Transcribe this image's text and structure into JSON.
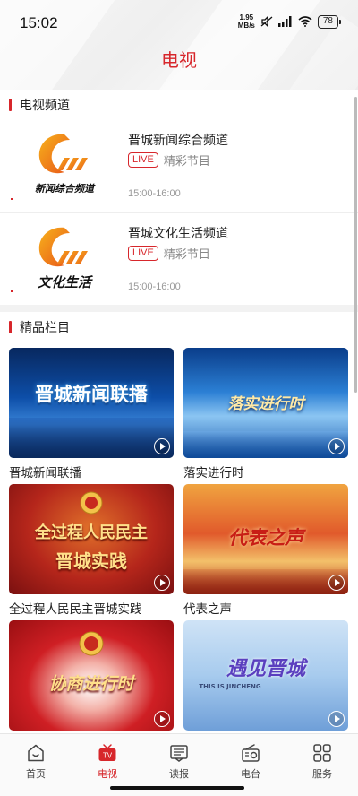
{
  "status": {
    "time": "15:02",
    "net_speed_value": "1.95",
    "net_speed_unit": "MB/s",
    "battery": "78"
  },
  "header": {
    "title": "电视"
  },
  "channels_section": {
    "title": "电视频道",
    "items": [
      {
        "logo_text": "新闻综合频道",
        "name": "晋城新闻综合频道",
        "live_label": "LIVE",
        "program": "精彩节目",
        "time": "15:00-16:00"
      },
      {
        "logo_text": "文化生活",
        "name": "晋城文化生活频道",
        "live_label": "LIVE",
        "program": "精彩节目",
        "time": "15:00-16:00"
      }
    ]
  },
  "programs_section": {
    "title": "精品栏目",
    "items": [
      {
        "title": "晋城新闻联播",
        "thumb_text": "晋城新闻联播"
      },
      {
        "title": "落实进行时",
        "thumb_text": "落实进行时"
      },
      {
        "title": "全过程人民民主晋城实践",
        "thumb_text_1": "全过程人民民主",
        "thumb_text_2": "晋城实践"
      },
      {
        "title": "代表之声",
        "thumb_text": "代表之声"
      },
      {
        "title": "",
        "thumb_text": "协商进行时"
      },
      {
        "title": "",
        "thumb_text": "遇见晋城",
        "thumb_sub": "THIS IS JINCHENG"
      }
    ]
  },
  "tabbar": {
    "items": [
      {
        "label": "首页",
        "icon": "home-icon"
      },
      {
        "label": "电视",
        "icon": "tv-icon",
        "badge": "TV"
      },
      {
        "label": "读报",
        "icon": "newspaper-icon"
      },
      {
        "label": "电台",
        "icon": "radio-icon"
      },
      {
        "label": "服务",
        "icon": "services-grid-icon"
      }
    ]
  },
  "colors": {
    "accent": "#d7262b",
    "live": "#d7262b"
  }
}
